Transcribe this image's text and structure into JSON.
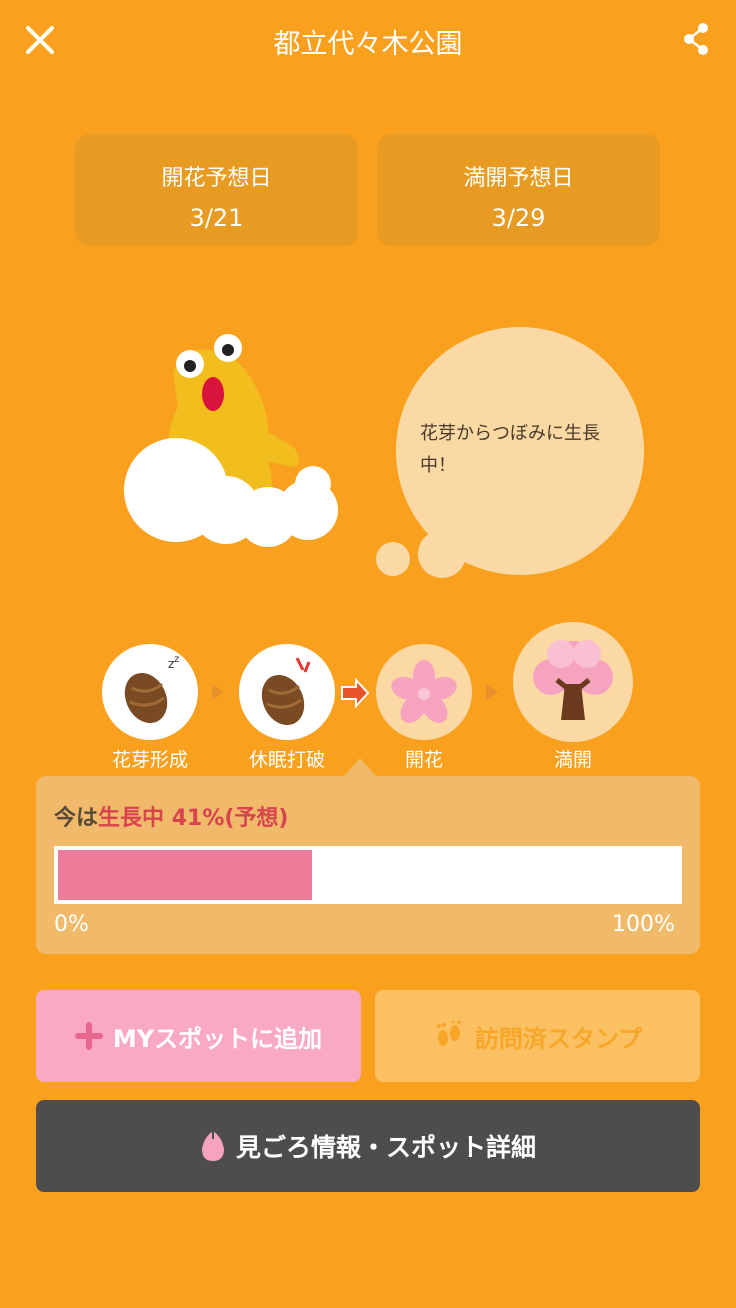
{
  "header": {
    "title": "都立代々木公園"
  },
  "dates": [
    {
      "label": "開花予想日",
      "value": "3/21"
    },
    {
      "label": "満開予想日",
      "value": "3/29"
    }
  ],
  "bubble": {
    "line1": "花芽からつぼみに生長",
    "line2": "中！"
  },
  "stages": [
    {
      "label": "花芽形成"
    },
    {
      "label": "休眠打破"
    },
    {
      "label": "開花"
    },
    {
      "label": "満開"
    }
  ],
  "progress": {
    "prefix": "今は",
    "status": "生長中",
    "percent_text": "41%(予想)",
    "value": 0.41,
    "min_label": "0%",
    "max_label": "100%"
  },
  "buttons": {
    "add_my_spot": "MYスポットに追加",
    "visit_stamp": "訪問済スタンプ",
    "details": "見ごろ情報・スポット詳細"
  },
  "colors": {
    "background": "#F9A11E",
    "card": "#E89B22",
    "bubble": "#FBD9A4",
    "progress_fill": "#EC7B99",
    "status_red": "#D8434E",
    "my_button": "#F9A9C3",
    "stamp_button": "#FBC062",
    "detail_button": "#4D4D4D"
  },
  "icons": [
    "close-icon",
    "share-icon",
    "plus-icon",
    "footprints-icon",
    "petal-icon",
    "arrow-right-icon",
    "bud-sleeping-icon",
    "bud-awake-icon",
    "flower-icon",
    "tree-icon",
    "mascot-icon"
  ]
}
